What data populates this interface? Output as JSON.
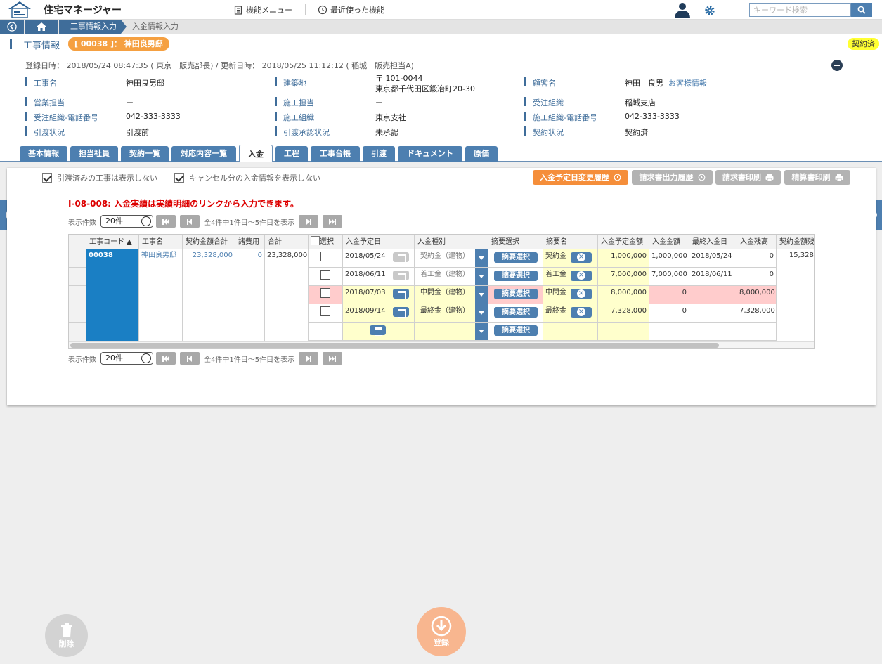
{
  "app": {
    "title": "住宅マネージャー",
    "menu_label": "機能メニュー",
    "recent_label": "最近使った機能",
    "search_placeholder": "キーワード検索"
  },
  "breadcrumb": {
    "parent": "工事情報入力",
    "current": "入金情報入力"
  },
  "section": {
    "title": "工事情報",
    "pill": "[ 00038 ]： 神田良男邸",
    "status": "契約済"
  },
  "info": {
    "registered": "登録日時： 2018/05/24 08:47:35 ( 東京　販売部長) / 更新日時： 2018/05/25 11:12:12 ( 稲城　販売担当A)",
    "fields": {
      "kouji_name": {
        "label": "工事名",
        "value": "神田良男邸"
      },
      "site": {
        "label": "建築地",
        "postal": "〒 101-0044",
        "address": "東京都千代田区鍛冶町20-30"
      },
      "customer": {
        "label": "顧客名",
        "value": "神田　良男",
        "link": "お客様情報"
      },
      "sales": {
        "label": "営業担当",
        "value": "ー"
      },
      "construct_staff": {
        "label": "施工担当",
        "value": "ー"
      },
      "order_org": {
        "label": "受注組織",
        "value": "稲城支店"
      },
      "order_tel": {
        "label": "受注組織-電話番号",
        "value": "042-333-3333"
      },
      "construct_org": {
        "label": "施工組織",
        "value": "東京支社"
      },
      "construct_tel": {
        "label": "施工組織-電話番号",
        "value": "042-333-3333"
      },
      "handover": {
        "label": "引渡状況",
        "value": "引渡前"
      },
      "handover_approval": {
        "label": "引渡承認状況",
        "value": "未承認"
      },
      "contract": {
        "label": "契約状況",
        "value": "契約済"
      }
    }
  },
  "tabs": [
    "基本情報",
    "担当社員",
    "契約一覧",
    "対応内容一覧",
    "入金",
    "工程",
    "工事台帳",
    "引渡",
    "ドキュメント",
    "原価"
  ],
  "filters": {
    "hide_handed": "引渡済みの工事は表示しない",
    "hide_cancel": "キャンセル分の入金情報を表示しない"
  },
  "toolbar": {
    "history": "入金予定日変更履歴",
    "invoice_history": "請求書出力履歴",
    "invoice_print": "請求書印刷",
    "settle_print": "精算書印刷"
  },
  "message": "I-08-008: 入金実績は実績明細のリンクから入力できます。",
  "pager": {
    "label": "表示件数",
    "size": "20件",
    "summary": "全4件中1件目〜5件目を表示"
  },
  "grid": {
    "headers": [
      "工事コード ▲",
      "工事名",
      "契約金額合計",
      "諸費用",
      "合計",
      "選択",
      "入金予定日",
      "入金種別",
      "摘要選択",
      "摘要名",
      "入金予定金額",
      "入金金額",
      "最終入金日",
      "入金残高",
      "契約金額残"
    ],
    "project": {
      "code": "00038",
      "name": "神田良男邸",
      "contract_total": "23,328,000",
      "misc": "0",
      "total": "23,328,000",
      "contract_remain": "15,328,"
    },
    "summary_btn": "摘要選択",
    "rows": [
      {
        "date": "2018/05/24",
        "type": "契約金（建物）",
        "summary": "契約金",
        "planned": "1,000,000",
        "paid": "1,000,000",
        "last": "2018/05/24",
        "balance": "0"
      },
      {
        "date": "2018/06/11",
        "type": "着工金（建物）",
        "summary": "着工金",
        "planned": "7,000,000",
        "paid": "7,000,000",
        "last": "2018/06/11",
        "balance": "0"
      },
      {
        "date": "2018/07/03",
        "type": "中間金（建物）",
        "summary": "中間金",
        "planned": "8,000,000",
        "paid": "0",
        "last": "",
        "balance": "8,000,000"
      },
      {
        "date": "2018/09/14",
        "type": "最終金（建物）",
        "summary": "最終金",
        "planned": "7,328,000",
        "paid": "0",
        "last": "",
        "balance": "7,328,000"
      }
    ]
  },
  "actions": {
    "delete": "削除",
    "register": "登録"
  }
}
